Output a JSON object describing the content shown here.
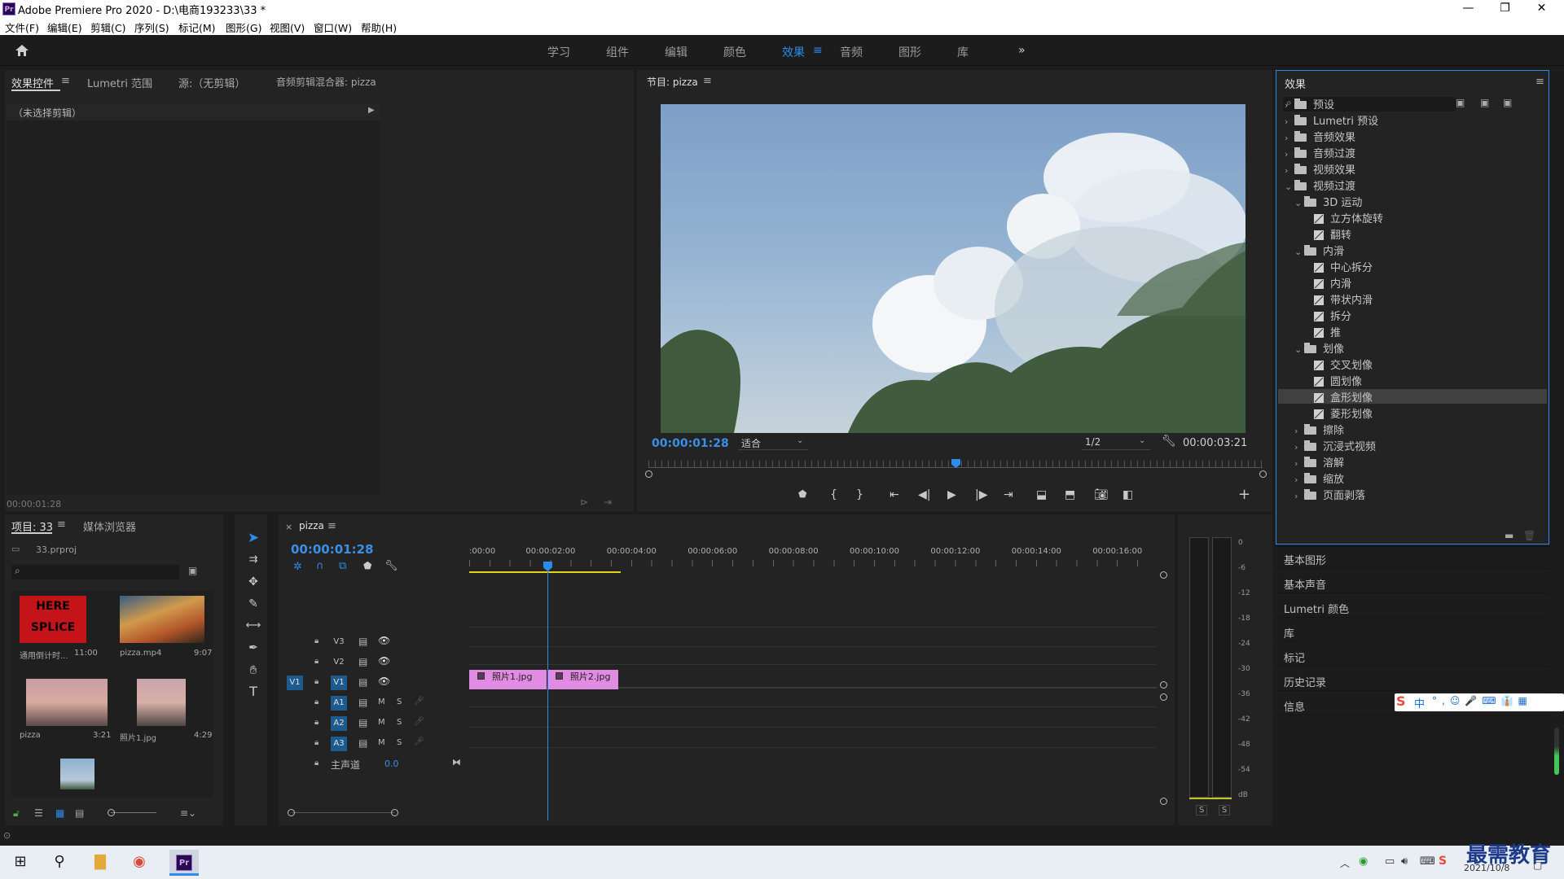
{
  "window": {
    "title": "Adobe Premiere Pro 2020 - D:\\电商193233\\33 *",
    "controls": {
      "minimize": "—",
      "restore": "❐",
      "close": "✕"
    }
  },
  "menu": [
    "文件(F)",
    "编辑(E)",
    "剪辑(C)",
    "序列(S)",
    "标记(M)",
    "图形(G)",
    "视图(V)",
    "窗口(W)",
    "帮助(H)"
  ],
  "workspaces": {
    "items": [
      "学习",
      "组件",
      "编辑",
      "颜色",
      "效果",
      "音频",
      "图形",
      "库"
    ],
    "active": "效果",
    "more": "»"
  },
  "effect_controls": {
    "tabs": [
      "效果控件",
      "Lumetri 范围",
      "源:（无剪辑）",
      "音频剪辑混合器: pizza"
    ],
    "no_clip": "（未选择剪辑）",
    "timecode": "00:00:01:28"
  },
  "program_monitor": {
    "title": "节目: pizza",
    "timecode": "00:00:01:28",
    "fit": "适合",
    "resolution": "1/2",
    "duration": "00:00:03:21",
    "playhead_fraction": 0.5
  },
  "effects_panel": {
    "title": "效果",
    "tree": [
      {
        "type": "folder",
        "level": 0,
        "open": false,
        "label": "预设"
      },
      {
        "type": "folder",
        "level": 0,
        "open": false,
        "label": "Lumetri 预设"
      },
      {
        "type": "folder",
        "level": 0,
        "open": false,
        "label": "音频效果"
      },
      {
        "type": "folder",
        "level": 0,
        "open": false,
        "label": "音频过渡"
      },
      {
        "type": "folder",
        "level": 0,
        "open": false,
        "label": "视频效果"
      },
      {
        "type": "folder",
        "level": 0,
        "open": true,
        "label": "视频过渡"
      },
      {
        "type": "folder",
        "level": 1,
        "open": true,
        "label": "3D 运动"
      },
      {
        "type": "fx",
        "level": 2,
        "label": "立方体旋转"
      },
      {
        "type": "fx",
        "level": 2,
        "label": "翻转"
      },
      {
        "type": "folder",
        "level": 1,
        "open": true,
        "label": "内滑"
      },
      {
        "type": "fx",
        "level": 2,
        "label": "中心拆分"
      },
      {
        "type": "fx",
        "level": 2,
        "label": "内滑"
      },
      {
        "type": "fx",
        "level": 2,
        "label": "带状内滑"
      },
      {
        "type": "fx",
        "level": 2,
        "label": "拆分"
      },
      {
        "type": "fx",
        "level": 2,
        "label": "推"
      },
      {
        "type": "folder",
        "level": 1,
        "open": true,
        "label": "划像"
      },
      {
        "type": "fx",
        "level": 2,
        "label": "交叉划像"
      },
      {
        "type": "fx",
        "level": 2,
        "label": "圆划像"
      },
      {
        "type": "fx",
        "level": 2,
        "label": "盒形划像",
        "selected": true
      },
      {
        "type": "fx",
        "level": 2,
        "label": "菱形划像"
      },
      {
        "type": "folder",
        "level": 1,
        "open": false,
        "label": "擦除"
      },
      {
        "type": "folder",
        "level": 1,
        "open": false,
        "label": "沉浸式视频"
      },
      {
        "type": "folder",
        "level": 1,
        "open": false,
        "label": "溶解"
      },
      {
        "type": "folder",
        "level": 1,
        "open": false,
        "label": "缩放"
      },
      {
        "type": "folder",
        "level": 1,
        "open": false,
        "label": "页面剥落"
      }
    ],
    "collapsed_panels": [
      "基本图形",
      "基本声音",
      "Lumetri 颜色",
      "库",
      "标记",
      "历史记录",
      "信息"
    ]
  },
  "project": {
    "tabs": [
      "项目: 33",
      "媒体浏览器"
    ],
    "file": "33.prproj",
    "items": [
      {
        "name": "通用倒计时...",
        "duration": "11:00",
        "thumb_text": "HERE SPLICE"
      },
      {
        "name": "pizza.mp4",
        "duration": "9:07"
      },
      {
        "name": "pizza",
        "duration": "3:21"
      },
      {
        "name": "照片1.jpg",
        "duration": "4:29"
      }
    ]
  },
  "timeline": {
    "sequence": "pizza",
    "timecode": "00:00:01:28",
    "ruler": [
      ":00:00",
      "00:00:02:00",
      "00:00:04:00",
      "00:00:06:00",
      "00:00:08:00",
      "00:00:10:00",
      "00:00:12:00",
      "00:00:14:00",
      "00:00:16:00"
    ],
    "video_tracks": [
      "V3",
      "V2",
      "V1"
    ],
    "audio_tracks": [
      "A1",
      "A2",
      "A3"
    ],
    "source_patch": "V1",
    "master_label": "主声道",
    "master_value": "0.0",
    "track_buttons": {
      "mute": "M",
      "solo": "S"
    },
    "clips": [
      {
        "label": "照片1.jpg",
        "start_sec": 0.0,
        "end_sec": 1.93
      },
      {
        "label": "照片2.jpg",
        "start_sec": 1.93,
        "end_sec": 3.7
      }
    ],
    "playhead_sec": 1.93
  },
  "audio_meter": {
    "scale": [
      "0",
      "-6",
      "-12",
      "-18",
      "-24",
      "-30",
      "-36",
      "-42",
      "-48",
      "-54",
      "dB"
    ],
    "solo": [
      "S",
      "S"
    ]
  },
  "taskbar": {
    "time": "",
    "date": "2021/10/8",
    "watermark": "最需教育",
    "ime": "中"
  }
}
